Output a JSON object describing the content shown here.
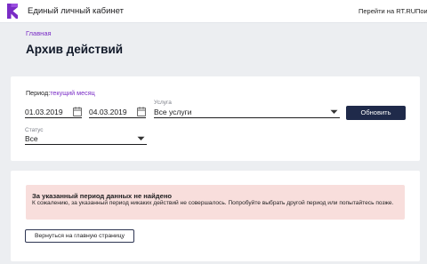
{
  "header": {
    "title": "Единый личный кабинет",
    "links": [
      "Перейти на RT.RU",
      "Пои"
    ]
  },
  "breadcrumb": "Главная",
  "page_title": "Архив действий",
  "filters": {
    "period_label": "Период:",
    "period_value": "текущий месяц",
    "date_from": "01.03.2019",
    "date_to": "04.03.2019",
    "service_label": "Услуга",
    "service_value": "Все услуги",
    "status_label": "Статус",
    "status_value": "Все",
    "refresh_button": "Обновить"
  },
  "result": {
    "alert_title": "За указанный период данных не найдено",
    "alert_text": "К сожалению, за указанный период никаких действий не совершалось. Попробуйте выбрать другой период или попытайтесь позже.",
    "back_button": "Вернуться на главную страницу"
  },
  "colors": {
    "accent": "#7a2cc6",
    "primary_button": "#1f2a4a",
    "alert_background": "#f8dedc"
  },
  "icons": [
    "rostelecom-logo",
    "calendar-icon",
    "chevron-down-icon"
  ]
}
